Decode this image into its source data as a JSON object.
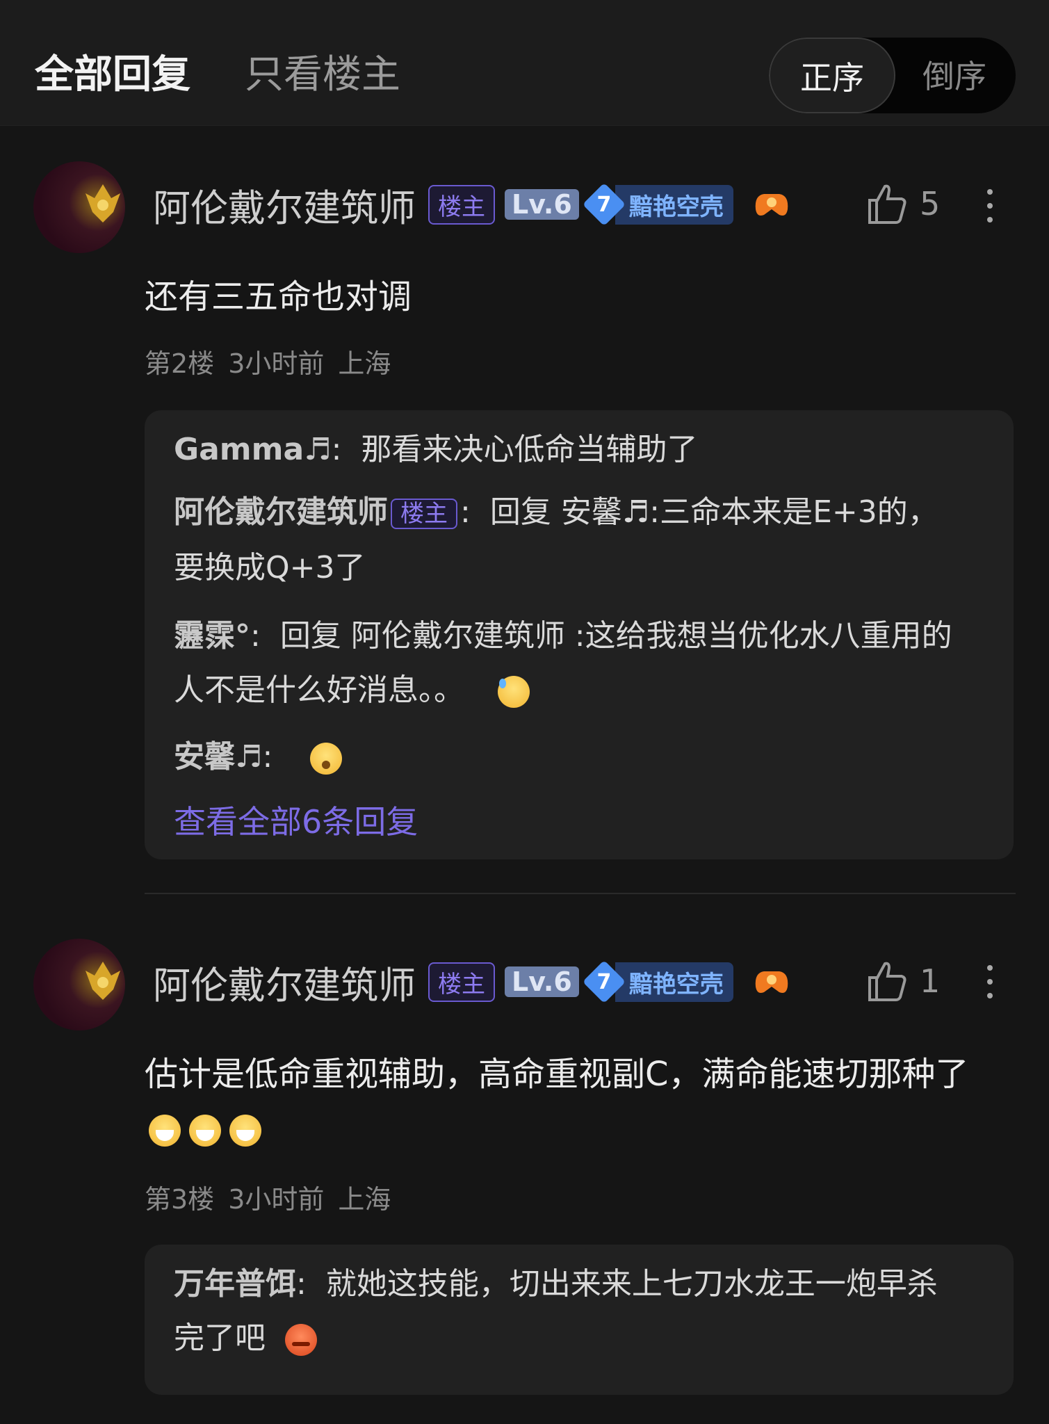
{
  "tabs": {
    "all": "全部回复",
    "owner_only": "只看楼主"
  },
  "sort": {
    "asc": "正序",
    "desc": "倒序"
  },
  "comments": [
    {
      "author": "阿伦戴尔建筑师",
      "owner_badge": "楼主",
      "level": "Lv.6",
      "medal_num": "7",
      "medal_text": "黯艳空壳",
      "likes": "5",
      "text": "还有三五命也对调",
      "floor": "第2楼",
      "time": "3小时前",
      "location": "上海",
      "replies": [
        {
          "name": "Gamma♬",
          "sep": ":",
          "text": "那看来决心低命当辅助了"
        },
        {
          "name": "阿伦戴尔建筑师",
          "badge": "楼主",
          "sep": ":",
          "text_line1": "回复 安馨♬:三命本来是E+3的，",
          "text_line2": "要换成Q+3了"
        },
        {
          "name": "靋霂°",
          "sep": ":",
          "text_line1": "回复 阿伦戴尔建筑师 :这给我想当优化水八重用的",
          "text_line2": "人不是什么好消息。。"
        },
        {
          "name": "安馨♬",
          "sep": ":"
        }
      ],
      "view_all": "查看全部6条回复"
    },
    {
      "author": "阿伦戴尔建筑师",
      "owner_badge": "楼主",
      "level": "Lv.6",
      "medal_num": "7",
      "medal_text": "黯艳空壳",
      "likes": "1",
      "text": "估计是低命重视辅助，高命重视副C，满命能速切那种了",
      "floor": "第3楼",
      "time": "3小时前",
      "location": "上海",
      "replies": [
        {
          "name": "万年普饵",
          "sep": ":",
          "text_line1": "就她这技能，切出来来上七刀水龙王一炮早杀",
          "text_line2": "完了吧"
        }
      ]
    }
  ],
  "colors": {
    "accent_purple": "#7d6ce6",
    "medal_blue": "#4a8ff2",
    "bg": "#151515"
  }
}
